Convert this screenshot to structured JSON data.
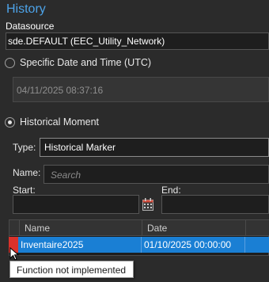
{
  "panel": {
    "title": "History"
  },
  "datasource": {
    "label": "Datasource",
    "value": "sde.DEFAULT (EEC_Utility_Network)"
  },
  "options": {
    "specific_label": "Specific Date and Time (UTC)",
    "specific_value": "04/11/2025 08:37:16",
    "moment_label": "Historical Moment",
    "selected": "moment"
  },
  "moment": {
    "type_label": "Type:",
    "type_value": "Historical Marker",
    "name_label": "Name:",
    "name_placeholder": "Search",
    "start_label": "Start:",
    "end_label": "End:"
  },
  "grid": {
    "columns": [
      "Name",
      "Date"
    ],
    "rows": [
      {
        "name": "Inventaire2025",
        "date": "01/10/2025 00:00:00",
        "selected": true
      }
    ]
  },
  "tooltip": {
    "text": "Function not implemented"
  },
  "colors": {
    "accent": "#4da3e8",
    "selection": "#1a7fd4",
    "marker": "#d9322b"
  },
  "icons": {
    "calendar": "calendar-icon",
    "cursor": "mouse-pointer-icon"
  }
}
